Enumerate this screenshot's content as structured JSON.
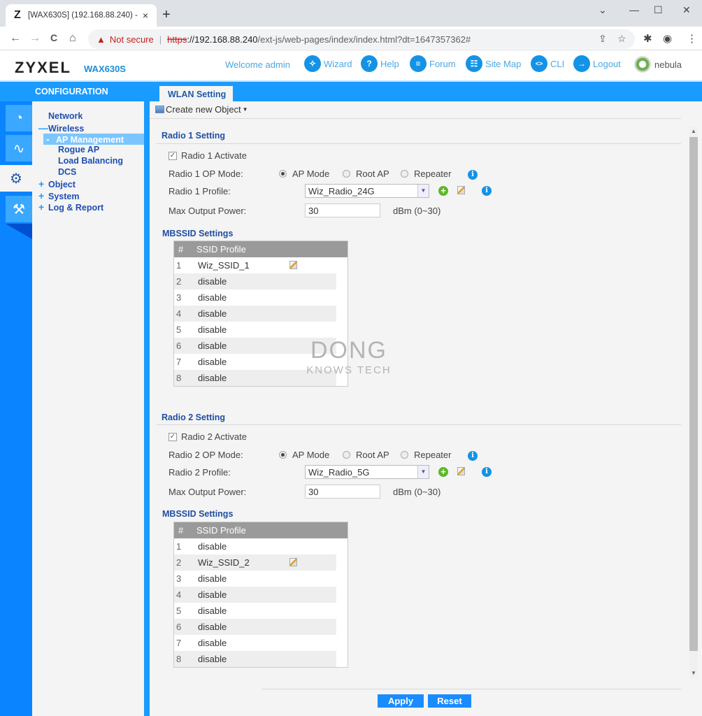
{
  "browser": {
    "tab_title": "[WAX630S] (192.168.88.240) - .:: ",
    "tab_favicon": "Z",
    "close_tab": "×",
    "new_tab": "+",
    "not_secure": "Not secure",
    "url_scheme": "https",
    "url_host": "://192.168.88.240",
    "url_path": "/ext-js/web-pages/index/index.html?dt=1647357362#",
    "icons": {
      "back": "←",
      "forward": "→",
      "reload": "C",
      "home": "⌂",
      "share": "⇪",
      "star": "☆",
      "extensions": "✱",
      "profile": "◉",
      "menu": "⋮",
      "tab_search": "⌄",
      "minimize": "—",
      "maximize": "☐",
      "close": "✕",
      "warning": "▲"
    }
  },
  "header": {
    "logo": "ZYXEL",
    "model": "WAX630S",
    "welcome": "Welcome admin",
    "links": [
      {
        "label": "Wizard",
        "icon": "wand-icon",
        "glyph": "✧"
      },
      {
        "label": "Help",
        "icon": "help-icon",
        "glyph": "?"
      },
      {
        "label": "Forum",
        "icon": "forum-icon",
        "glyph": "≡"
      },
      {
        "label": "Site Map",
        "icon": "sitemap-icon",
        "glyph": "☷"
      },
      {
        "label": "CLI",
        "icon": "cli-icon",
        "glyph": "<>"
      },
      {
        "label": "Logout",
        "icon": "logout-icon",
        "glyph": "→"
      }
    ],
    "nebula": "nebula"
  },
  "bar": {
    "section": "CONFIGURATION",
    "tab": "WLAN Setting"
  },
  "rail": {
    "icons": [
      "dashboard-icon",
      "monitor-icon",
      "configuration-icon",
      "maintenance-icon"
    ],
    "glyphs": [
      "◔",
      "∿",
      "⚙",
      "⚒"
    ]
  },
  "tree": {
    "items": [
      {
        "label": "Network",
        "sign": ""
      },
      {
        "label": "Wireless",
        "sign": "—"
      },
      {
        "label": "AP Management",
        "sign": "-"
      },
      {
        "label": "Rogue AP",
        "sign": ""
      },
      {
        "label": "Load Balancing",
        "sign": ""
      },
      {
        "label": "DCS",
        "sign": ""
      },
      {
        "label": "Object",
        "sign": "+"
      },
      {
        "label": "System",
        "sign": "+"
      },
      {
        "label": "Log & Report",
        "sign": "+"
      }
    ]
  },
  "content": {
    "create_object": "Create new Object",
    "radios": [
      {
        "heading": "Radio 1 Setting",
        "activate_label": "Radio 1 Activate",
        "activate_checked": true,
        "op_mode_label": "Radio 1 OP Mode:",
        "op_modes": [
          "AP Mode",
          "Root AP",
          "Repeater"
        ],
        "op_mode_selected": "AP Mode",
        "profile_label": "Radio 1 Profile:",
        "profile_value": "Wiz_Radio_24G",
        "power_label": "Max Output Power:",
        "power_value": "30",
        "power_unit": "dBm (0~30)",
        "mbssid_heading": "MBSSID Settings",
        "table_headers": [
          "#",
          "SSID Profile"
        ],
        "rows": [
          {
            "n": "1",
            "profile": "Wiz_SSID_1",
            "editable": true
          },
          {
            "n": "2",
            "profile": "disable"
          },
          {
            "n": "3",
            "profile": "disable"
          },
          {
            "n": "4",
            "profile": "disable"
          },
          {
            "n": "5",
            "profile": "disable"
          },
          {
            "n": "6",
            "profile": "disable"
          },
          {
            "n": "7",
            "profile": "disable"
          },
          {
            "n": "8",
            "profile": "disable"
          }
        ]
      },
      {
        "heading": "Radio 2 Setting",
        "activate_label": "Radio 2 Activate",
        "activate_checked": true,
        "op_mode_label": "Radio 2 OP Mode:",
        "op_modes": [
          "AP Mode",
          "Root AP",
          "Repeater"
        ],
        "op_mode_selected": "AP Mode",
        "profile_label": "Radio 2 Profile:",
        "profile_value": "Wiz_Radio_5G",
        "power_label": "Max Output Power:",
        "power_value": "30",
        "power_unit": "dBm (0~30)",
        "mbssid_heading": "MBSSID Settings",
        "table_headers": [
          "#",
          "SSID Profile"
        ],
        "rows": [
          {
            "n": "1",
            "profile": "disable"
          },
          {
            "n": "2",
            "profile": "Wiz_SSID_2",
            "editable": true
          },
          {
            "n": "3",
            "profile": "disable"
          },
          {
            "n": "4",
            "profile": "disable"
          },
          {
            "n": "5",
            "profile": "disable"
          },
          {
            "n": "6",
            "profile": "disable"
          },
          {
            "n": "7",
            "profile": "disable"
          },
          {
            "n": "8",
            "profile": "disable"
          }
        ]
      }
    ],
    "watermark": {
      "line1": "DONG",
      "line2": "KNOWS TECH"
    },
    "apply": "Apply",
    "reset": "Reset"
  }
}
